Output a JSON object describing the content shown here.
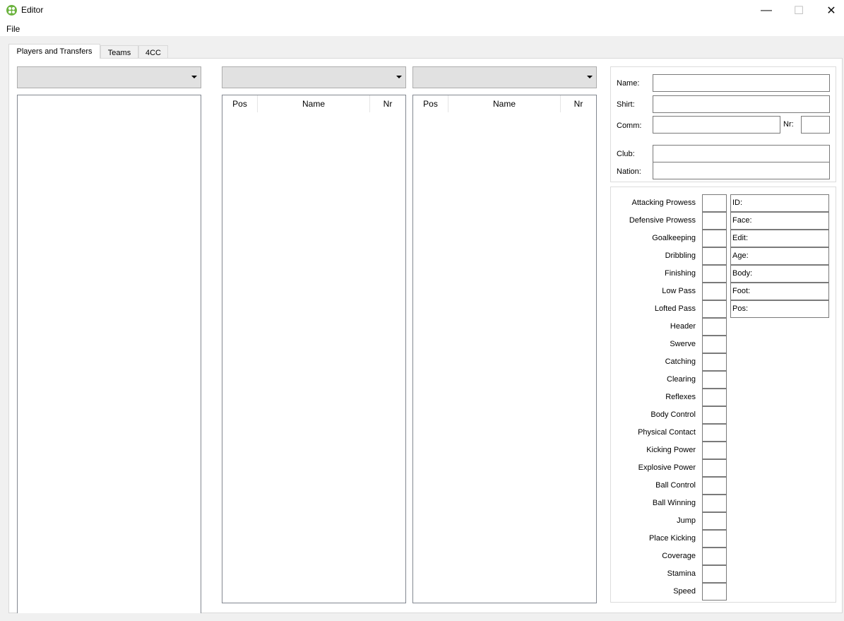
{
  "window": {
    "title": "Editor"
  },
  "menu": {
    "file": "File"
  },
  "tabs": [
    "Players and Transfers",
    "Teams",
    "4CC"
  ],
  "table_columns": {
    "pos": "Pos",
    "name": "Name",
    "nr": "Nr"
  },
  "player_fields": {
    "name": "Name:",
    "shirt": "Shirt:",
    "comm": "Comm:",
    "nr": "Nr:",
    "club": "Club:",
    "nation": "Nation:"
  },
  "stats": [
    "Attacking Prowess",
    "Defensive Prowess",
    "Goalkeeping",
    "Dribbling",
    "Finishing",
    "Low Pass",
    "Lofted Pass",
    "Header",
    "Swerve",
    "Catching",
    "Clearing",
    "Reflexes",
    "Body Control",
    "Physical Contact",
    "Kicking Power",
    "Explosive Power",
    "Ball Control",
    "Ball Winning",
    "Jump",
    "Place Kicking",
    "Coverage",
    "Stamina",
    "Speed"
  ],
  "info": [
    "ID:",
    "Face:",
    "Edit:",
    "Age:",
    "Body:",
    "Foot:",
    "Pos:"
  ],
  "colors": {
    "app_icon": "#6cb33f",
    "window_bg": "#f0f0f0",
    "combo_bg": "#e1e1e1"
  }
}
